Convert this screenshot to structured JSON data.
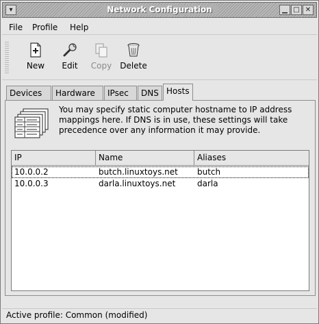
{
  "window": {
    "title": "Network Configuration",
    "menu_icon": "chevron-down-icon",
    "min_icon": "minimize-icon",
    "max_icon": "maximize-icon",
    "close_icon": "close-icon"
  },
  "menubar": {
    "file": "File",
    "profile": "Profile",
    "help": "Help"
  },
  "toolbar": {
    "new_label": "New",
    "edit_label": "Edit",
    "copy_label": "Copy",
    "delete_label": "Delete",
    "copy_enabled": false
  },
  "tabs": [
    {
      "label": "Devices",
      "active": false
    },
    {
      "label": "Hardware",
      "active": false
    },
    {
      "label": "IPsec",
      "active": false
    },
    {
      "label": "DNS",
      "active": false
    },
    {
      "label": "Hosts",
      "active": true
    }
  ],
  "hosts": {
    "info": "You may specify static computer hostname to IP address mappings here.  If DNS is in use, these settings will take precedence over any information it may provide.",
    "columns": [
      "IP",
      "Name",
      "Aliases"
    ],
    "rows": [
      {
        "ip": "10.0.0.2",
        "name": "butch.linuxtoys.net",
        "aliases": "butch"
      },
      {
        "ip": "10.0.0.3",
        "name": "darla.linuxtoys.net",
        "aliases": "darla"
      }
    ]
  },
  "status": "Active profile: Common (modified)"
}
